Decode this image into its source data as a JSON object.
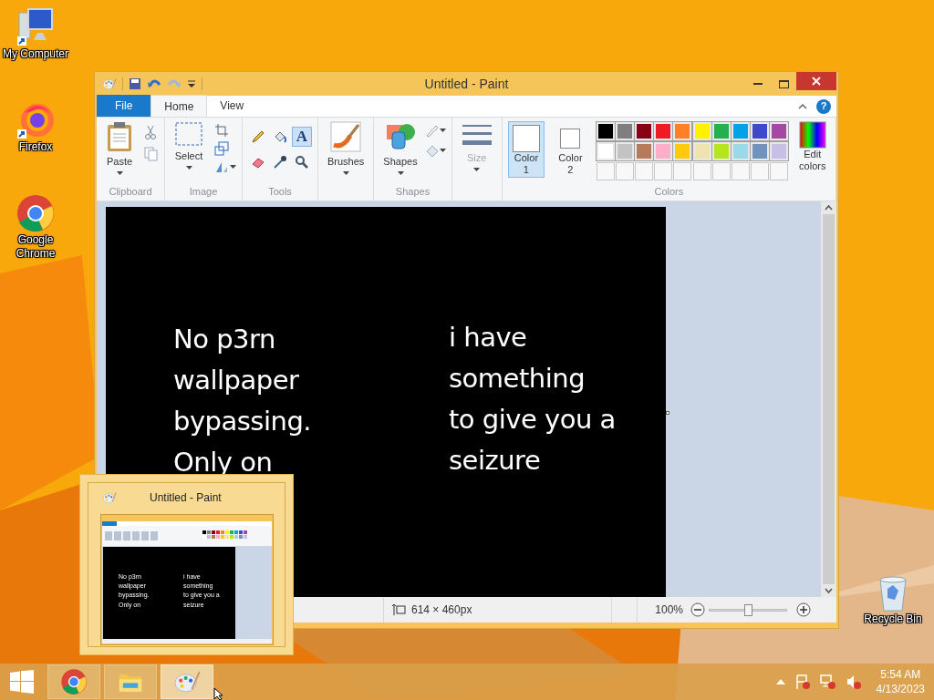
{
  "desktop_icons": [
    {
      "kind": "computer",
      "label": "My Computer"
    },
    {
      "kind": "firefox",
      "label": "Firefox"
    },
    {
      "kind": "chrome",
      "label": "Google Chrome"
    },
    {
      "kind": "recycle",
      "label": "Recycle Bin"
    }
  ],
  "paint": {
    "title": "Untitled - Paint",
    "help": "?",
    "tabs": [
      {
        "label": "File",
        "kind": "file",
        "selected": false
      },
      {
        "label": "Home",
        "kind": "tab",
        "selected": true
      },
      {
        "label": "View",
        "kind": "tab",
        "selected": false
      }
    ],
    "groups": [
      {
        "kind": "clipboard",
        "label": "Clipboard",
        "button": "Paste",
        "disabled": false
      },
      {
        "label": "Image",
        "button": "Select",
        "disabled": false
      },
      {
        "kind": "tools",
        "label": "Tools",
        "tools": [
          {
            "kind": "pencil",
            "selected": false
          },
          {
            "kind": "fill",
            "selected": false
          },
          {
            "kind": "text",
            "glyph": "A",
            "selected": true
          },
          {
            "kind": "eraser",
            "selected": false
          },
          {
            "kind": "picker",
            "selected": false
          },
          {
            "kind": "magnifier",
            "selected": false
          }
        ]
      },
      {
        "kind": "brushes",
        "button": "Brushes",
        "disabled": false
      },
      {
        "kind": "shapes",
        "label": "Shapes",
        "button": "Shapes",
        "disabled": false
      },
      {
        "kind": "size",
        "button": "Size",
        "disabled": true
      },
      {
        "kind": "colors",
        "label": "Colors",
        "slots": [
          {
            "label": "Color",
            "number": "1",
            "selected": true
          },
          {
            "label": "Color",
            "number": "2",
            "selected": false
          }
        ],
        "palette": [
          {
            "color": "#000000"
          },
          {
            "color": "#7f7f7f"
          },
          {
            "color": "#880015"
          },
          {
            "color": "#ed1c24"
          },
          {
            "color": "#ff7f27"
          },
          {
            "color": "#fff200"
          },
          {
            "color": "#22b14c"
          },
          {
            "color": "#00a2e8"
          },
          {
            "color": "#3f48cc"
          },
          {
            "color": "#a349a4"
          },
          {
            "color": "#ffffff"
          },
          {
            "color": "#c3c3c3"
          },
          {
            "color": "#b97a57"
          },
          {
            "color": "#ffaec9"
          },
          {
            "color": "#ffc90e"
          },
          {
            "color": "#efe4b0"
          },
          {
            "color": "#b5e61d"
          },
          {
            "color": "#99d9ea"
          },
          {
            "color": "#7092be"
          },
          {
            "color": "#c8bfe7"
          }
        ],
        "edit_colors": "Edit colors"
      }
    ],
    "canvas": {
      "left_text": [
        "No p3rn",
        "wallpaper",
        "bypassing.",
        "Only on"
      ],
      "right_text": [
        "i have",
        "something",
        "to give you a",
        "seizure"
      ]
    },
    "status": {
      "size": "614 × 460px",
      "zoom": "100%",
      "zoom_slider": {
        "level": 0.5
      }
    }
  },
  "thumbnail": {
    "title": "Untitled - Paint",
    "left_text": [
      "No p3rn",
      "wallpaper",
      "bypassing.",
      "Only on"
    ],
    "right_text": [
      "i have",
      "something",
      "to give you a",
      "seizure"
    ]
  },
  "taskbar": {
    "apps": [
      {
        "kind": "chrome",
        "active": false
      },
      {
        "kind": "explorer",
        "active": false
      },
      {
        "kind": "paint",
        "active": true
      }
    ],
    "time": "5:54 AM",
    "date": "4/13/2023"
  }
}
